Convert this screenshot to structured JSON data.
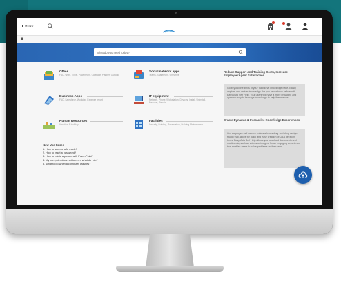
{
  "topbar": {
    "menu_label": "MENU"
  },
  "search": {
    "placeholder": "What do you need today?"
  },
  "tiles": [
    {
      "title": "Office",
      "subtitle": "FAQ, Word, Excel, PowerPoint, Calendar, Planner, Outlook",
      "icon": "office-folders-icon"
    },
    {
      "title": "Social network apps",
      "subtitle": "Teams, SharePoint, OneDrive",
      "icon": "social-network-icon"
    },
    {
      "title": "Business Apps",
      "subtitle": "FAQ, Salesforce, Workday, Expense report",
      "icon": "business-apps-icon"
    },
    {
      "title": "IT equipment",
      "subtitle": "Network, Phone, Workstation, Devices, Install, Uninstall, Request, Repair",
      "icon": "it-equipment-icon"
    },
    {
      "title": "Human Resources",
      "subtitle": "Vacation & Holiday",
      "icon": "human-resources-icon"
    },
    {
      "title": "Facilities",
      "subtitle": "Security, Building, Reservation, Building Maintenance",
      "icon": "facilities-icon"
    }
  ],
  "new_use_cases": {
    "title": "New Use Cases",
    "items": [
      "1. How to access safe mode?",
      "2. How to reset a password?",
      "3. How to rotate a picture with PowerPoint?",
      "4. My computer does not turn on, what do I do?",
      "5. What to do when a computer crashes?"
    ]
  },
  "right_panel": {
    "section1_heading": "Reduce Support and Training Costs, Increase Employee/Agent Satisfaction",
    "section1_text": "Go beyond the limits of your traditional knowledge base. Easily capture and deliver knowledge like you never have before with EasyVista Self Help. Your users will have a more engaging and dynamic way to leverage knowledge to help themselves.",
    "section2_heading": "Create Dynamic & Interactive Knowledge Experiences",
    "section2_text": "Our employee self-service software has a drag-and-drop design studio that allows for quick and easy creation of Q&A decision trees. EasyVista Self Help allows you to upload documents and multimedia, such as videos or images, for an engaging experience that enables users to solve problems on their own."
  },
  "colors": {
    "hero_blue": "#2f72c2",
    "fab_blue": "#1e5fae",
    "backdrop_teal": "#13757c",
    "notification_red": "#d93a2b"
  }
}
